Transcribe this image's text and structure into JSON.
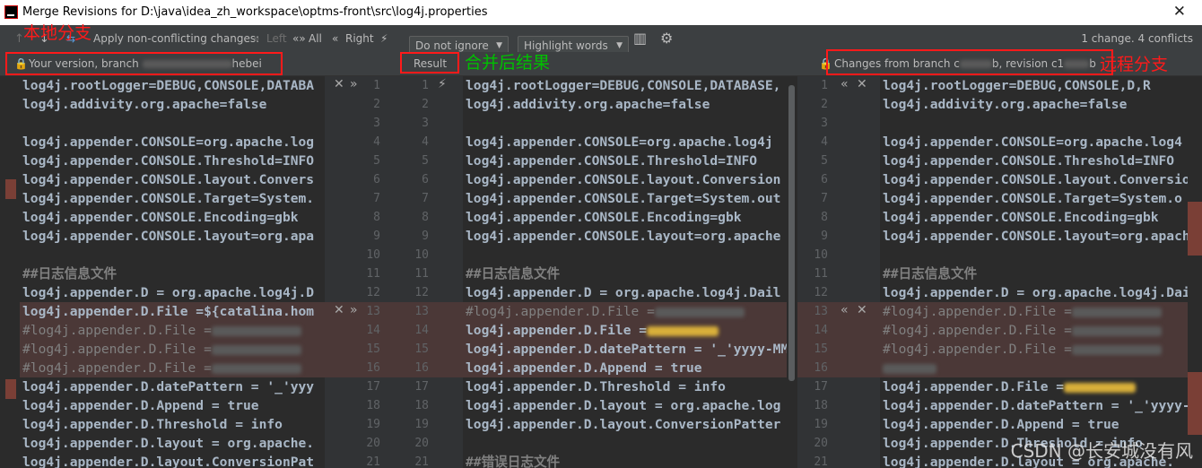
{
  "window": {
    "title": "Merge Revisions for D:\\java\\idea_zh_workspace\\optms-front\\src\\log4j.properties",
    "close_glyph": "✕"
  },
  "toolbar": {
    "apply_label": "Apply non-conflicting changes:",
    "left_label": "Left",
    "all_label": "All",
    "right_label": "Right",
    "ignore_select": "Do not ignore",
    "highlight_select": "Highlight words",
    "status": "1 change. 4 conflicts"
  },
  "headers": {
    "left": "Your version, branch ",
    "left_branch": "hebei",
    "result": "Result",
    "right_prefix": "Changes from branch c",
    "right_mid": "b, revision c1",
    "right_suffix": "b"
  },
  "annotations": {
    "local": "本地分支",
    "merged": "合并后结果",
    "remote": "远程分支",
    "watermark": "CSDN @长安城没有风"
  },
  "left_lines": [
    "log4j.rootLogger=DEBUG,CONSOLE,DATABA",
    "log4j.addivity.org.apache=false",
    "",
    "log4j.appender.CONSOLE=org.apache.log",
    "log4j.appender.CONSOLE.Threshold=INFO",
    "log4j.appender.CONSOLE.layout.Convers",
    "log4j.appender.CONSOLE.Target=System.",
    "log4j.appender.CONSOLE.Encoding=gbk",
    "log4j.appender.CONSOLE.layout=org.apa",
    "",
    "##日志信息文件",
    "log4j.appender.D = org.apache.log4j.D",
    "log4j.appender.D.File =${catalina.hom",
    "#log4j.appender.D.File =",
    "#log4j.appender.D.File =",
    "#log4j.appender.D.File =",
    "log4j.appender.D.datePattern = '_'yyy",
    "log4j.appender.D.Append = true",
    "log4j.appender.D.Threshold = info",
    "log4j.appender.D.layout = org.apache.",
    "log4j.appender.D.layout.ConversionPat"
  ],
  "mid_lines": [
    "log4j.rootLogger=DEBUG,CONSOLE,DATABASE,",
    "log4j.addivity.org.apache=false",
    "",
    "log4j.appender.CONSOLE=org.apache.log4j",
    "log4j.appender.CONSOLE.Threshold=INFO",
    "log4j.appender.CONSOLE.layout.Conversion",
    "log4j.appender.CONSOLE.Target=System.out",
    "log4j.appender.CONSOLE.Encoding=gbk",
    "log4j.appender.CONSOLE.layout=org.apache",
    "",
    "##日志信息文件",
    "log4j.appender.D = org.apache.log4j.Dail",
    "#log4j.appender.D.File =",
    "log4j.appender.D.File =",
    "log4j.appender.D.datePattern = '_'yyyy-MM",
    "log4j.appender.D.Append = true",
    "log4j.appender.D.Threshold = info",
    "log4j.appender.D.layout = org.apache.log",
    "log4j.appender.D.layout.ConversionPatter",
    "",
    "##错误日志文件"
  ],
  "right_lines": [
    "log4j.rootLogger=DEBUG,CONSOLE,D,R",
    "log4j.addivity.org.apache=false",
    "",
    "log4j.appender.CONSOLE=org.apache.log4",
    "log4j.appender.CONSOLE.Threshold=INFO",
    "log4j.appender.CONSOLE.layout.Conversio",
    "log4j.appender.CONSOLE.Target=System.o",
    "log4j.appender.CONSOLE.Encoding=gbk",
    "log4j.appender.CONSOLE.layout=org.apach",
    "",
    "##日志信息文件",
    "log4j.appender.D = org.apache.log4j.Dai",
    "#log4j.appender.D.File =",
    "#log4j.appender.D.File =",
    "#log4j.appender.D.File =",
    "",
    "log4j.appender.D.File =",
    "log4j.appender.D.datePattern = '_'yyyy-",
    "log4j.appender.D.Append = true",
    "log4j.appender.D.Threshold = info",
    "log4j.appender.D.layout = org.apache."
  ],
  "gutter_left_nums": [
    "1",
    "2",
    "3",
    "4",
    "5",
    "6",
    "7",
    "8",
    "9",
    "10",
    "11",
    "12",
    "13",
    "14",
    "15",
    "16",
    "17",
    "18",
    "19",
    "20",
    "21"
  ],
  "gutter_right_nums": [
    "1",
    "2",
    "3",
    "4",
    "5",
    "6",
    "7",
    "8",
    "9",
    "10",
    "11",
    "12",
    "13",
    "14",
    "15",
    "16",
    "17",
    "18",
    "19",
    "20",
    "21"
  ],
  "colors": {
    "conflict": "#4b3837",
    "editor_bg": "#2b2b2b",
    "annotation_red": "#ff1a1a",
    "annotation_green": "#00c000"
  }
}
